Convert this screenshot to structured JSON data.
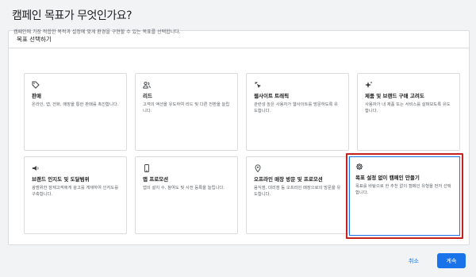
{
  "page": {
    "title": "캠페인 목표가 무엇인가요?"
  },
  "panel": {
    "header": "목표 선택하기",
    "description": "캠페인에 가장 적합한 목적과 설정에 맞게 환경을 구현할 수 있는 목표를 선택합니다."
  },
  "goals": [
    {
      "icon": "tag-icon",
      "title": "판매",
      "desc": "온라인, 앱, 전화, 매장을 통한 판매를 촉진합니다."
    },
    {
      "icon": "people-icon",
      "title": "리드",
      "desc": "고객의 액션을 유도하여 리드 및 다른 전환을 늘립니다."
    },
    {
      "icon": "sparkle-cursor-icon",
      "title": "웹사이트 트래픽",
      "desc": "관련성 높은 사용자가 웹사이트를 방문하도록 유도합니다."
    },
    {
      "icon": "sparkle-icon",
      "title": "제품 및 브랜드 구매 고려도",
      "desc": "사용자가 내 제품 또는 서비스를 살펴보도록 유도합니다."
    },
    {
      "icon": "megaphone-icon",
      "title": "브랜드 인지도 및 도달범위",
      "desc": "광범위한 잠재고객에게 광고를 게재하여 인지도를 구축합니다."
    },
    {
      "icon": "phone-icon",
      "title": "앱 프로모션",
      "desc": "앱의 설치 수, 참여도 및 사전 등록을 늘립니다."
    },
    {
      "icon": "location-pin-icon",
      "title": "오프라인 매장 방문 및 프로모션",
      "desc": "음식점, 대리점 등 오프라인 매장으로의 방문을 유도합니다."
    },
    {
      "icon": "gear-icon",
      "title": "목표 설정 없이 캠페인 만들기",
      "desc": "목표를 바탕으로 한 추천 없이 캠페인 유형을 먼저 선택합니다."
    }
  ],
  "footer": {
    "cancel": "취소",
    "continue": "계속"
  },
  "colors": {
    "accent": "#1a73e8",
    "highlight": "#c5221f"
  }
}
